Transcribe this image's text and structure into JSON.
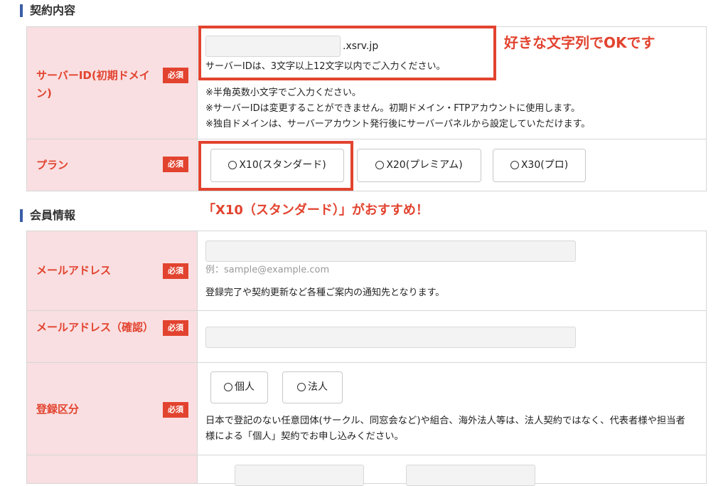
{
  "sections": {
    "contract": "契約内容",
    "member": "会員情報"
  },
  "required_badge": "必須",
  "server_id": {
    "label": "サーバーID(初期ドメイン)",
    "domain_suffix": ".xsrv.jp",
    "hint": "サーバーIDは、3文字以上12文字以内でご入力ください。",
    "notes": [
      "※半角英数小文字でご入力ください。",
      "※サーバーIDは変更することができません。初期ドメイン・FTPアカウントに使用します。",
      "※独自ドメインは、サーバーアカウント発行後にサーバーパネルから設定していただけます。"
    ],
    "value": ""
  },
  "plan": {
    "label": "プラン",
    "options": [
      "X10(スタンダード)",
      "X20(プレミアム)",
      "X30(プロ)"
    ]
  },
  "email": {
    "label": "メールアドレス",
    "placeholder": "例：sample@example.com",
    "note": "登録完了や契約更新など各種ご案内の通知先となります。",
    "value": ""
  },
  "email_confirm": {
    "label": "メールアドレス（確認）",
    "value": ""
  },
  "registration_type": {
    "label": "登録区分",
    "options": [
      "個人",
      "法人"
    ],
    "note": "日本で登記のない任意団体(サークル、同窓会など)や組合、海外法人等は、法人契約ではなく、代表者様や担当者様による「個人」契約でお申し込みください。"
  },
  "annotations": {
    "server_id": "好きな文字列でOKです",
    "plan": "「X10（スタンダード）」がおすすめ！"
  },
  "colors": {
    "accent_red": "#e2432f",
    "label_bg": "#f9dfe1",
    "section_bar": "#3b5ea8"
  }
}
